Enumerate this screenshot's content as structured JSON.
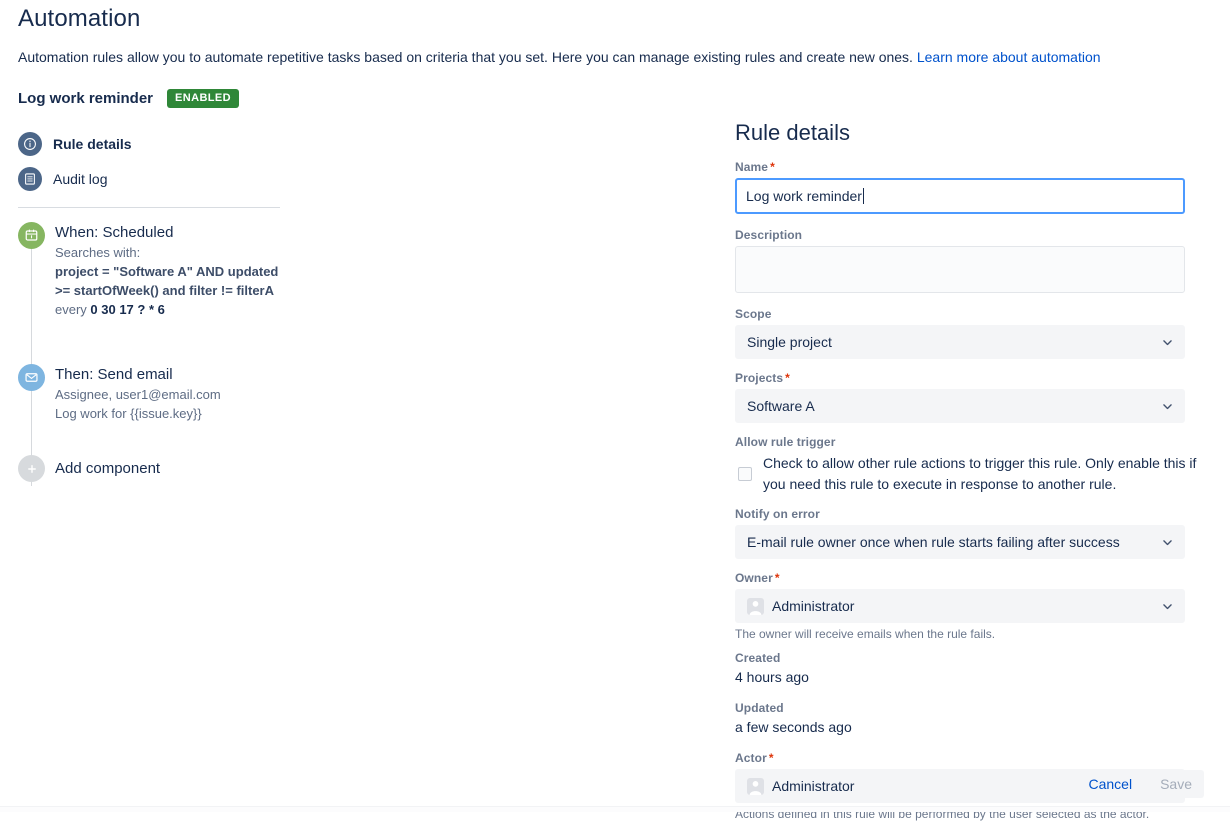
{
  "page": {
    "title": "Automation",
    "intro_text": "Automation rules allow you to automate repetitive tasks based on criteria that you set. Here you can manage existing rules and create new ones.",
    "intro_link": "Learn more about automation"
  },
  "rule_header": {
    "name": "Log work reminder",
    "status_badge": "ENABLED",
    "badge_color": "#2f8738"
  },
  "nav": {
    "items": [
      {
        "label": "Rule details",
        "icon": "info-circle-icon",
        "active": true
      },
      {
        "label": "Audit log",
        "icon": "document-list-icon",
        "active": false
      }
    ]
  },
  "chain": {
    "when": {
      "icon": "calendar-schedule-icon",
      "icon_color": "#86b661",
      "heading": "When: Scheduled",
      "sub_label": "Searches with:",
      "jql_line1": "project = \"Software A\" AND updated",
      "jql_line2": ">= startOfWeek() and filter != filterA",
      "schedule_prefix": "every ",
      "schedule_cron": "0 30 17 ? * 6"
    },
    "then": {
      "icon": "envelope-icon",
      "icon_color": "#7eb5e0",
      "heading": "Then: Send email",
      "recipients": "Assignee, user1@email.com",
      "subject": "Log work for {{issue.key}}"
    },
    "add": {
      "icon": "plus-circle-icon",
      "icon_color": "#d7dadd",
      "label": "Add component"
    }
  },
  "details": {
    "panel_title": "Rule details",
    "name": {
      "label": "Name",
      "required": "*",
      "value": "Log work reminder"
    },
    "description": {
      "label": "Description",
      "value": "",
      "placeholder": ""
    },
    "scope": {
      "label": "Scope",
      "value": "Single project"
    },
    "projects": {
      "label": "Projects",
      "required": "*",
      "value": "Software A"
    },
    "allow_rule_trigger": {
      "label": "Allow rule trigger",
      "checked": false,
      "description": "Check to allow other rule actions to trigger this rule. Only enable this if you need this rule to execute in response to another rule."
    },
    "notify_on_error": {
      "label": "Notify on error",
      "value": "E-mail rule owner once when rule starts failing after success"
    },
    "owner": {
      "label": "Owner",
      "required": "*",
      "value": "Administrator",
      "help": "The owner will receive emails when the rule fails."
    },
    "created": {
      "label": "Created",
      "value": "4 hours ago"
    },
    "updated": {
      "label": "Updated",
      "value": "a few seconds ago"
    },
    "actor": {
      "label": "Actor",
      "required": "*",
      "value": "Administrator",
      "help": "Actions defined in this rule will be performed by the user selected as the actor."
    }
  },
  "footer": {
    "cancel_label": "Cancel",
    "save_label": "Save",
    "save_disabled": true
  },
  "colors": {
    "link": "#0052cc",
    "focus_border": "#4c9aff",
    "required": "#de350b",
    "label": "#6b778c"
  }
}
